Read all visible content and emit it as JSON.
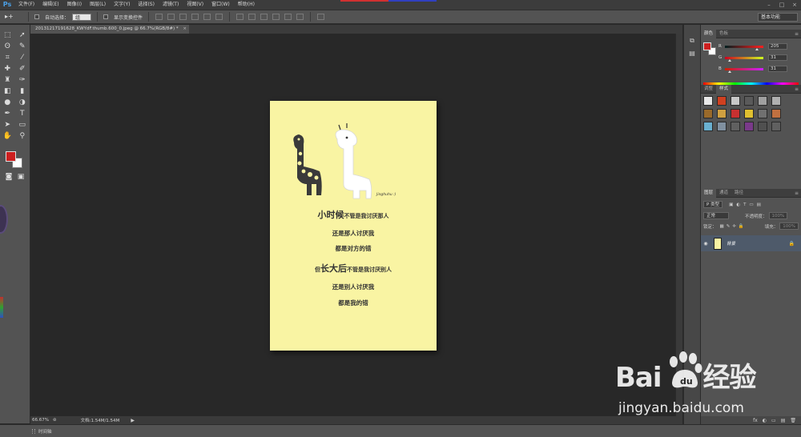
{
  "app": {
    "logo": "Ps",
    "menus": [
      "文件(F)",
      "编辑(E)",
      "图像(I)",
      "图层(L)",
      "文字(Y)",
      "选择(S)",
      "滤镜(T)",
      "视图(V)",
      "窗口(W)",
      "帮助(H)"
    ],
    "window_buttons": [
      "–",
      "□",
      "×"
    ]
  },
  "options": {
    "tool_glyph": "▸+",
    "auto_select_label": "自动选择：",
    "auto_select_value": "组",
    "show_transform_label": "显示变换控件",
    "workspace": "基本功能"
  },
  "document": {
    "tab_title": "20131217191628_KWYdF.thumb.600_0.jpeg @ 66.7%(RGB/8#) *",
    "close": "×",
    "lines": [
      {
        "big": "小时候",
        "rest": "不管是我讨厌那人"
      },
      {
        "big": "",
        "rest": "还是那人讨厌我"
      },
      {
        "big": "",
        "rest": "都是对方的错"
      },
      {
        "big": "长大后",
        "prefix": "但",
        "rest": "不管是我讨厌别人"
      },
      {
        "big": "",
        "rest": "还是别人讨厌我"
      },
      {
        "big": "",
        "rest": "都是我的错"
      }
    ],
    "signature": "Jinghuhu :)"
  },
  "status": {
    "zoom": "66.67%",
    "doc_size": "文档:1.54M/1.54M",
    "arrow": "▶"
  },
  "timeline": {
    "label": "时间轴"
  },
  "color_panel": {
    "tabs": [
      "颜色",
      "色板"
    ],
    "channels": [
      {
        "name": "R",
        "value": "205"
      },
      {
        "name": "G",
        "value": "31"
      },
      {
        "name": "B",
        "value": "31"
      }
    ],
    "foreground": "#cd1f1f",
    "background": "#ffffff"
  },
  "styles_panel": {
    "tabs": [
      "调整",
      "样式"
    ],
    "swatches": [
      "#e8e8e8",
      "#d04020",
      "#c8c8c8",
      "#5a5a5a",
      "#a0a0a0",
      "#b0b0b0",
      "#9a6a2a",
      "#d0a040",
      "#c83030",
      "#e0c030",
      "#707070",
      "#c07040",
      "#6ab0d0",
      "#8090a0",
      "#606060",
      "#7a3a8a",
      "#505050",
      "#606060"
    ]
  },
  "layers_panel": {
    "tabs": [
      "图层",
      "通道",
      "路径"
    ],
    "kind": "P 类型",
    "blend": "正常",
    "opacity_label": "不透明度：",
    "opacity": "100%",
    "lock_label": "锁定：",
    "fill_label": "填充：",
    "fill": "100%",
    "layer_name": "背景",
    "footer_icons": [
      "fx",
      "◐",
      "▭",
      "▤",
      "🗑"
    ]
  },
  "watermark": {
    "logo_left": "Bai",
    "logo_right": "经验",
    "url": "jingyan.baidu.com"
  }
}
